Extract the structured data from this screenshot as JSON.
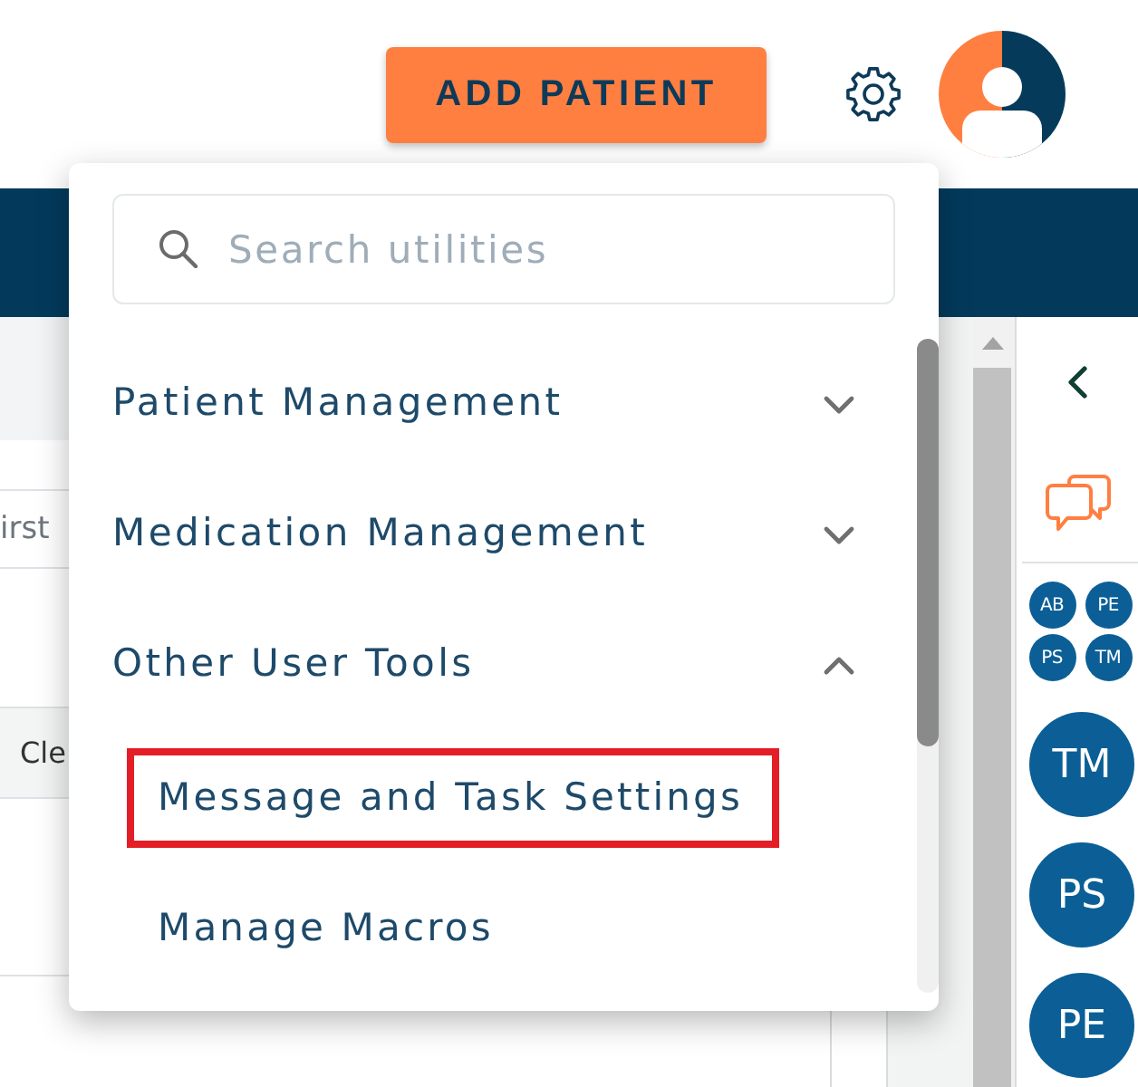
{
  "header": {
    "add_button": "ADD PATIENT"
  },
  "background": {
    "filter_field": {
      "placeholder": "irst"
    },
    "table_header": "Cle"
  },
  "utilities_menu": {
    "search": {
      "placeholder": "Search utilities"
    },
    "sections": [
      {
        "label": "Patient Management",
        "expanded": false
      },
      {
        "label": "Medication Management",
        "expanded": false
      },
      {
        "label": "Other User Tools",
        "expanded": true,
        "children": [
          {
            "label": "Message and Task Settings",
            "highlighted": true
          },
          {
            "label": "Manage Macros",
            "highlighted": false
          }
        ]
      }
    ]
  },
  "care_team": {
    "small_avatars": [
      {
        "initials": "AB"
      },
      {
        "initials": "PE"
      },
      {
        "initials": "PS"
      },
      {
        "initials": "TM"
      }
    ],
    "avatars": [
      {
        "initials": "TM"
      },
      {
        "initials": "PS"
      },
      {
        "initials": "PE"
      }
    ]
  }
}
